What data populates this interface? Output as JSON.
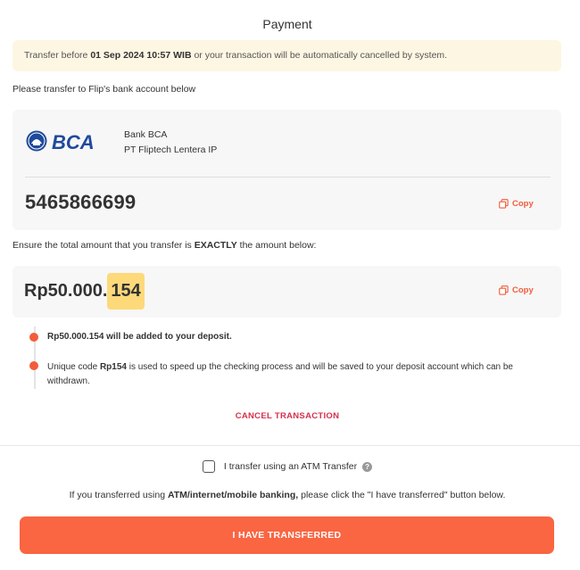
{
  "header": {
    "title": "Payment"
  },
  "warning": {
    "prefix": "Transfer before ",
    "deadline": "01 Sep 2024 10:57 WIB",
    "suffix": " or your transaction will be automatically cancelled by system."
  },
  "instruction": "Please transfer to Flip's bank account below",
  "bank": {
    "logo_text": "BCA",
    "name": "Bank BCA",
    "owner": "PT Fliptech Lentera IP",
    "account_number": "5465866699",
    "copy_label": "Copy"
  },
  "ensure": {
    "prefix": "Ensure the total amount that you transfer is ",
    "emphasis": "EXACTLY",
    "suffix": " the amount below:"
  },
  "amount": {
    "main": "Rp50.000.",
    "unique_code": "154",
    "copy_label": "Copy"
  },
  "notes": {
    "note1": "Rp50.000.154 will be added to your deposit.",
    "note2_prefix": "Unique code ",
    "note2_code": "Rp154",
    "note2_suffix": " is used to speed up the checking process and will be saved to your deposit account which can be withdrawn."
  },
  "cancel_label": "CANCEL TRANSACTION",
  "atm": {
    "label": "I transfer using an ATM Transfer",
    "help_icon": "?"
  },
  "footer_text": {
    "prefix": "If you transferred using ",
    "emphasis": "ATM/internet/mobile banking,",
    "suffix": " please click the \"I have transferred\" button below."
  },
  "primary_button": "I HAVE TRANSFERRED",
  "colors": {
    "accent": "#fa6542",
    "cancel": "#d4314d",
    "highlight": "#fdd97a",
    "warning_bg": "#fdf6e3",
    "bca_blue": "#1f4a9c"
  }
}
